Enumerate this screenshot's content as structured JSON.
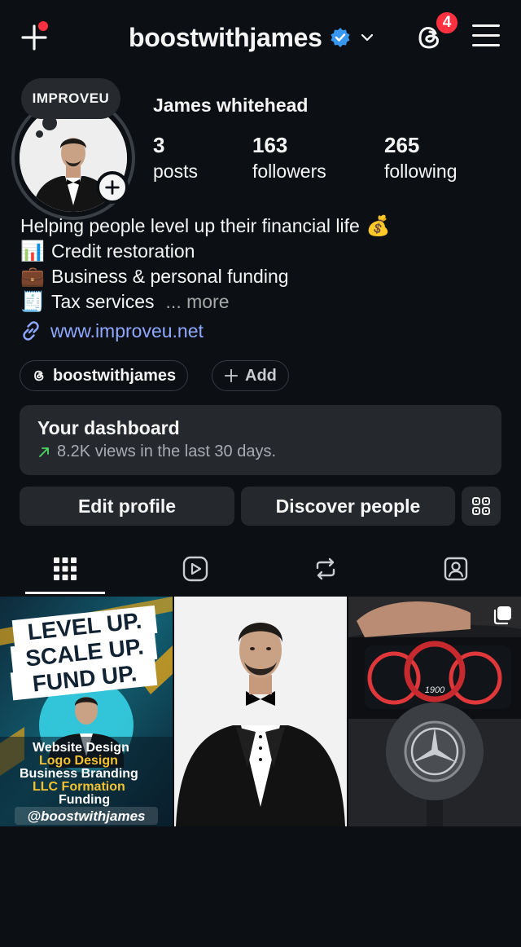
{
  "header": {
    "username": "boostwithjames",
    "notification_count": "4",
    "icons": [
      "plus-icon",
      "verified-badge-icon",
      "chevron-down-icon",
      "threads-icon",
      "menu-icon"
    ]
  },
  "profile": {
    "note": "IMPROVEU",
    "full_name": "James whitehead",
    "stats": [
      {
        "num": "3",
        "label": "posts"
      },
      {
        "num": "163",
        "label": "followers"
      },
      {
        "num": "265",
        "label": "following"
      }
    ],
    "bio": [
      {
        "text": "Helping people level up their financial life",
        "emoji": "💰",
        "emoji_position": "end"
      },
      {
        "text": "Credit restoration",
        "emoji": "📊",
        "emoji_position": "start"
      },
      {
        "text": "Business & personal funding",
        "emoji": "💼",
        "emoji_position": "start"
      },
      {
        "text": "Tax services",
        "emoji": "🧾",
        "emoji_position": "start"
      }
    ],
    "more_label": "... more",
    "link": "www.improveu.net"
  },
  "chips": {
    "threads_label": "boostwithjames",
    "add_label": "Add"
  },
  "dashboard": {
    "title": "Your dashboard",
    "subtitle": "8.2K views in the last 30 days."
  },
  "actions": {
    "edit_profile": "Edit profile",
    "discover_people": "Discover people"
  },
  "tabs": [
    {
      "name": "grid",
      "icon": "grid-icon",
      "active": true
    },
    {
      "name": "reels",
      "icon": "reels-icon",
      "active": false
    },
    {
      "name": "reposts",
      "icon": "repost-icon",
      "active": false
    },
    {
      "name": "tagged",
      "icon": "tagged-icon",
      "active": false
    }
  ],
  "posts": {
    "post1": {
      "headline": [
        "LEVEL UP.",
        "SCALE UP.",
        "FUND UP."
      ],
      "services": [
        "Website Design",
        "Logo Design",
        "Business Branding",
        "LLC Formation",
        "Funding"
      ],
      "handle": "@boostwithjames"
    },
    "post3": {
      "speed": "1900"
    }
  },
  "colors": {
    "background": "#0c1014",
    "surface": "#25292e",
    "link": "#8fa8ff",
    "badge": "#ff3040",
    "verified": "#3897f0",
    "trend": "#4cd964"
  }
}
